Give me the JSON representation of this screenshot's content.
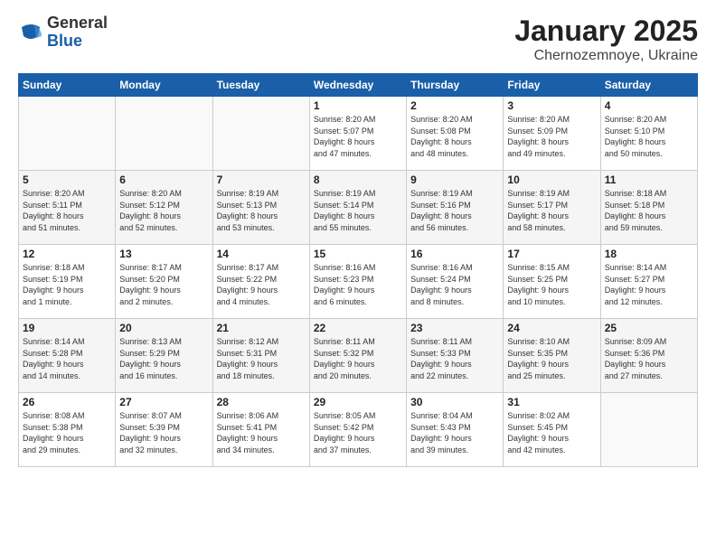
{
  "logo": {
    "general": "General",
    "blue": "Blue"
  },
  "header": {
    "month": "January 2025",
    "location": "Chernozemnoye, Ukraine"
  },
  "weekdays": [
    "Sunday",
    "Monday",
    "Tuesday",
    "Wednesday",
    "Thursday",
    "Friday",
    "Saturday"
  ],
  "weeks": [
    [
      {
        "day": "",
        "details": ""
      },
      {
        "day": "",
        "details": ""
      },
      {
        "day": "",
        "details": ""
      },
      {
        "day": "1",
        "details": "Sunrise: 8:20 AM\nSunset: 5:07 PM\nDaylight: 8 hours\nand 47 minutes."
      },
      {
        "day": "2",
        "details": "Sunrise: 8:20 AM\nSunset: 5:08 PM\nDaylight: 8 hours\nand 48 minutes."
      },
      {
        "day": "3",
        "details": "Sunrise: 8:20 AM\nSunset: 5:09 PM\nDaylight: 8 hours\nand 49 minutes."
      },
      {
        "day": "4",
        "details": "Sunrise: 8:20 AM\nSunset: 5:10 PM\nDaylight: 8 hours\nand 50 minutes."
      }
    ],
    [
      {
        "day": "5",
        "details": "Sunrise: 8:20 AM\nSunset: 5:11 PM\nDaylight: 8 hours\nand 51 minutes."
      },
      {
        "day": "6",
        "details": "Sunrise: 8:20 AM\nSunset: 5:12 PM\nDaylight: 8 hours\nand 52 minutes."
      },
      {
        "day": "7",
        "details": "Sunrise: 8:19 AM\nSunset: 5:13 PM\nDaylight: 8 hours\nand 53 minutes."
      },
      {
        "day": "8",
        "details": "Sunrise: 8:19 AM\nSunset: 5:14 PM\nDaylight: 8 hours\nand 55 minutes."
      },
      {
        "day": "9",
        "details": "Sunrise: 8:19 AM\nSunset: 5:16 PM\nDaylight: 8 hours\nand 56 minutes."
      },
      {
        "day": "10",
        "details": "Sunrise: 8:19 AM\nSunset: 5:17 PM\nDaylight: 8 hours\nand 58 minutes."
      },
      {
        "day": "11",
        "details": "Sunrise: 8:18 AM\nSunset: 5:18 PM\nDaylight: 8 hours\nand 59 minutes."
      }
    ],
    [
      {
        "day": "12",
        "details": "Sunrise: 8:18 AM\nSunset: 5:19 PM\nDaylight: 9 hours\nand 1 minute."
      },
      {
        "day": "13",
        "details": "Sunrise: 8:17 AM\nSunset: 5:20 PM\nDaylight: 9 hours\nand 2 minutes."
      },
      {
        "day": "14",
        "details": "Sunrise: 8:17 AM\nSunset: 5:22 PM\nDaylight: 9 hours\nand 4 minutes."
      },
      {
        "day": "15",
        "details": "Sunrise: 8:16 AM\nSunset: 5:23 PM\nDaylight: 9 hours\nand 6 minutes."
      },
      {
        "day": "16",
        "details": "Sunrise: 8:16 AM\nSunset: 5:24 PM\nDaylight: 9 hours\nand 8 minutes."
      },
      {
        "day": "17",
        "details": "Sunrise: 8:15 AM\nSunset: 5:25 PM\nDaylight: 9 hours\nand 10 minutes."
      },
      {
        "day": "18",
        "details": "Sunrise: 8:14 AM\nSunset: 5:27 PM\nDaylight: 9 hours\nand 12 minutes."
      }
    ],
    [
      {
        "day": "19",
        "details": "Sunrise: 8:14 AM\nSunset: 5:28 PM\nDaylight: 9 hours\nand 14 minutes."
      },
      {
        "day": "20",
        "details": "Sunrise: 8:13 AM\nSunset: 5:29 PM\nDaylight: 9 hours\nand 16 minutes."
      },
      {
        "day": "21",
        "details": "Sunrise: 8:12 AM\nSunset: 5:31 PM\nDaylight: 9 hours\nand 18 minutes."
      },
      {
        "day": "22",
        "details": "Sunrise: 8:11 AM\nSunset: 5:32 PM\nDaylight: 9 hours\nand 20 minutes."
      },
      {
        "day": "23",
        "details": "Sunrise: 8:11 AM\nSunset: 5:33 PM\nDaylight: 9 hours\nand 22 minutes."
      },
      {
        "day": "24",
        "details": "Sunrise: 8:10 AM\nSunset: 5:35 PM\nDaylight: 9 hours\nand 25 minutes."
      },
      {
        "day": "25",
        "details": "Sunrise: 8:09 AM\nSunset: 5:36 PM\nDaylight: 9 hours\nand 27 minutes."
      }
    ],
    [
      {
        "day": "26",
        "details": "Sunrise: 8:08 AM\nSunset: 5:38 PM\nDaylight: 9 hours\nand 29 minutes."
      },
      {
        "day": "27",
        "details": "Sunrise: 8:07 AM\nSunset: 5:39 PM\nDaylight: 9 hours\nand 32 minutes."
      },
      {
        "day": "28",
        "details": "Sunrise: 8:06 AM\nSunset: 5:41 PM\nDaylight: 9 hours\nand 34 minutes."
      },
      {
        "day": "29",
        "details": "Sunrise: 8:05 AM\nSunset: 5:42 PM\nDaylight: 9 hours\nand 37 minutes."
      },
      {
        "day": "30",
        "details": "Sunrise: 8:04 AM\nSunset: 5:43 PM\nDaylight: 9 hours\nand 39 minutes."
      },
      {
        "day": "31",
        "details": "Sunrise: 8:02 AM\nSunset: 5:45 PM\nDaylight: 9 hours\nand 42 minutes."
      },
      {
        "day": "",
        "details": ""
      }
    ]
  ]
}
